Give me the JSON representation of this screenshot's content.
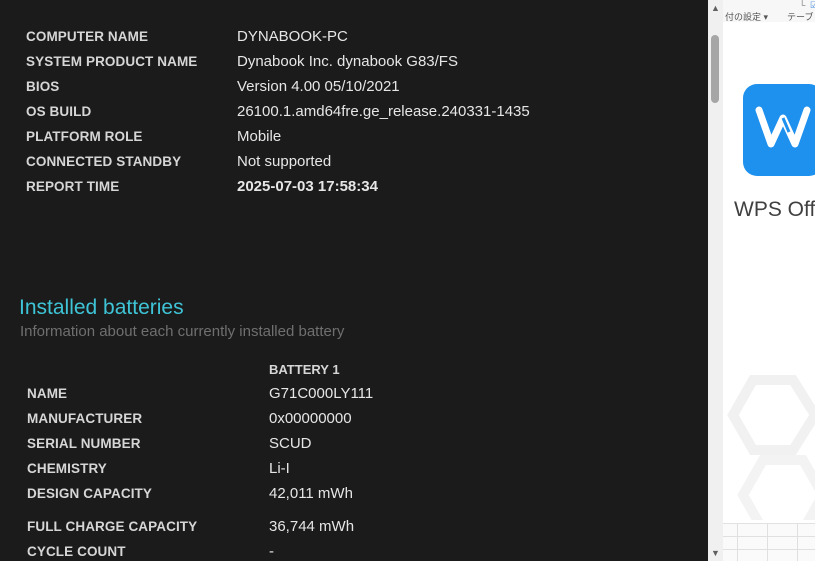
{
  "system_info": [
    {
      "label": "COMPUTER NAME",
      "value": "DYNABOOK-PC"
    },
    {
      "label": "SYSTEM PRODUCT NAME",
      "value": "Dynabook Inc. dynabook G83/FS"
    },
    {
      "label": "BIOS",
      "value": "Version 4.00 05/10/2021"
    },
    {
      "label": "OS BUILD",
      "value": "26100.1.amd64fre.ge_release.240331-1435"
    },
    {
      "label": "PLATFORM ROLE",
      "value": "Mobile"
    },
    {
      "label": "CONNECTED STANDBY",
      "value": "Not supported"
    },
    {
      "label": "REPORT TIME",
      "value": "2025-07-03  17:58:34"
    }
  ],
  "batteries": {
    "title": "Installed batteries",
    "subtitle": "Information about each currently installed battery",
    "column_header": "BATTERY 1",
    "rows": [
      {
        "label": "NAME",
        "value": "G71C000LY111"
      },
      {
        "label": "MANUFACTURER",
        "value": "0x00000000"
      },
      {
        "label": "SERIAL NUMBER",
        "value": "SCUD"
      },
      {
        "label": "CHEMISTRY",
        "value": "Li-I"
      },
      {
        "label": "DESIGN CAPACITY",
        "value": "42,011 mWh"
      },
      {
        "label": "FULL CHARGE CAPACITY",
        "value": "36,744 mWh"
      },
      {
        "label": "CYCLE COUNT",
        "value": "-"
      }
    ]
  },
  "scrollbar": {
    "up_glyph": "▲",
    "down_glyph": "▼"
  },
  "right_app": {
    "toolbar_text_1": "付の設定 ▾",
    "toolbar_text_2": "テーブ",
    "name": "WPS Off",
    "logo_color": "#1e90ee"
  },
  "colors": {
    "section_title": "#3ec4d6",
    "background": "#1b1b1b"
  }
}
